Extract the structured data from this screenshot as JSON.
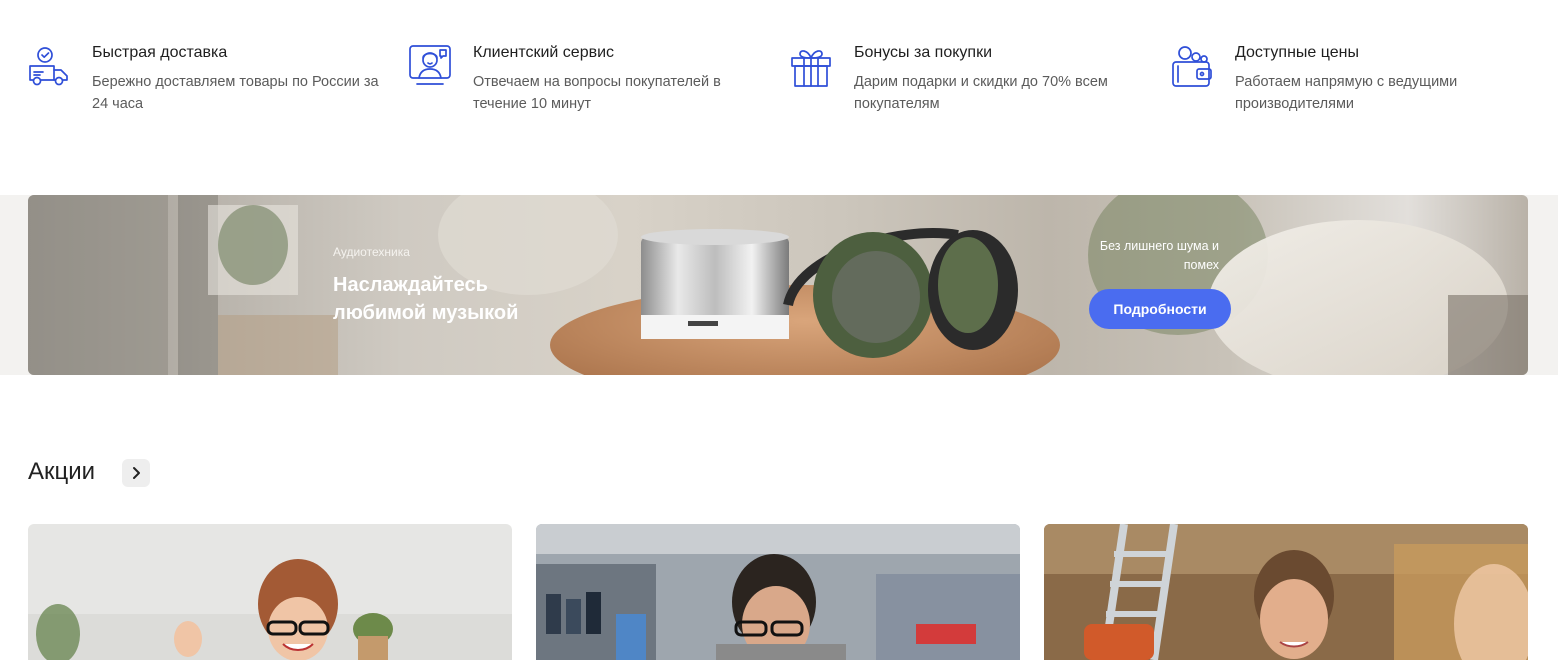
{
  "features": [
    {
      "icon": "delivery-truck-icon",
      "title": "Быстрая доставка",
      "description": "Бережно доставляем товары по России за 24 часа"
    },
    {
      "icon": "support-agent-icon",
      "title": "Клиентский сервис",
      "description": "Отвечаем на вопросы покупателей в течение 10 минут"
    },
    {
      "icon": "gift-icon",
      "title": "Бонусы за покупки",
      "description": "Дарим подарки и скидки до 70% всем покупателям"
    },
    {
      "icon": "wallet-icon",
      "title": "Доступные цены",
      "description": "Работаем напрямую с ведущими производителями"
    }
  ],
  "banner": {
    "category": "Аудиотехника",
    "title": "Наслаждайтесь любимой музыкой",
    "tagline": "Без лишнего шума и помех",
    "button_label": "Подробности"
  },
  "promotions": {
    "title": "Акции",
    "cards": [
      {
        "image": "woman-with-glasses-cheering"
      },
      {
        "image": "man-in-auto-parts-store"
      },
      {
        "image": "man-in-hardware-store"
      }
    ]
  },
  "colors": {
    "icon_blue": "#2f4fd8",
    "button_blue": "#4a6cf0"
  }
}
